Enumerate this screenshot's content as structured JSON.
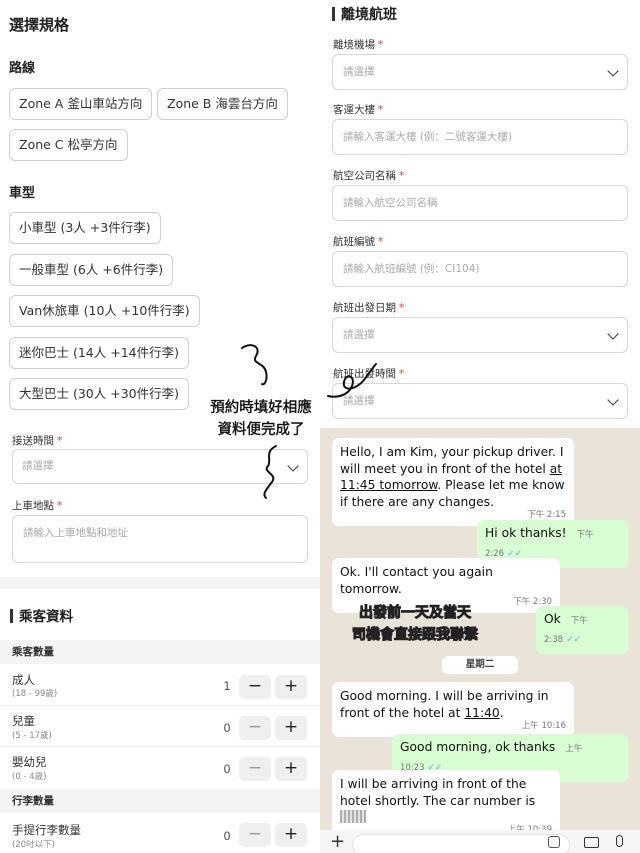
{
  "left": {
    "title": "選擇規格",
    "route": {
      "heading": "路線",
      "options": [
        "Zone A 釜山車站方向",
        "Zone B 海雲台方向",
        "Zone C 松亭方向"
      ]
    },
    "vehicle": {
      "heading": "車型",
      "options": [
        "小車型 (3人 +3件行李)",
        "一般車型 (6人 +6件行李)",
        "Van休旅車 (10人 +10件行李)",
        "迷你巴士 (14人 +14件行李)",
        "大型巴士 (30人 +30件行李)"
      ]
    },
    "pickup_time": {
      "label": "接送時間",
      "placeholder": "請選擇"
    },
    "pickup_place": {
      "label": "上車地點",
      "placeholder": "請輸入上車地點和地址"
    },
    "passenger": {
      "title": "乘客資料",
      "count_heading": "乘客數量",
      "rows": [
        {
          "label": "成人",
          "range": "(18 - 99歲)",
          "count": "1"
        },
        {
          "label": "兒童",
          "range": "(5 - 17歲)",
          "count": "0"
        },
        {
          "label": "嬰幼兒",
          "range": "(0 - 4歲)",
          "count": "0"
        }
      ],
      "luggage_heading": "行李數量",
      "luggage_rows": [
        {
          "label": "手提行李數量",
          "range": "(20吋以下)",
          "count": "0"
        }
      ],
      "minus": "−",
      "plus": "+"
    },
    "required_mark": "*"
  },
  "flight": {
    "title": "離境航班",
    "fields": [
      {
        "label": "離境機場",
        "placeholder": "請選擇",
        "type": "select"
      },
      {
        "label": "客運大樓",
        "placeholder": "請輸入客運大樓 (例：二號客運大樓)",
        "type": "input"
      },
      {
        "label": "航空公司名稱",
        "placeholder": "請輸入航空公司名稱",
        "type": "input"
      },
      {
        "label": "航班編號",
        "placeholder": "請輸入航班編號 (例：CI104)",
        "type": "input"
      },
      {
        "label": "航班出發日期",
        "placeholder": "請選擇",
        "type": "select"
      },
      {
        "label": "航班出發時間",
        "placeholder": "請選擇",
        "type": "select"
      }
    ]
  },
  "chat": {
    "messages": [
      {
        "dir": "in",
        "parts": [
          "Hello, I am Kim, your pickup driver. I will meet you in front of the hotel ",
          "at 11:45 tomorrow",
          ". Please let me know if there are any changes."
        ],
        "time": "下午 2:15"
      },
      {
        "dir": "out",
        "text": "Hi ok thanks!",
        "time": "下午 2:26"
      },
      {
        "dir": "in",
        "text": "Ok. I'll contact you again tomorrow.",
        "time": "下午 2:30"
      },
      {
        "dir": "out",
        "text": "Ok",
        "time": "下午 2:38"
      },
      {
        "dir": "in",
        "parts": [
          "Good morning. I will be arriving in front of the hotel at ",
          "11:40",
          "."
        ],
        "time": "上午 10:16"
      },
      {
        "dir": "out",
        "text": "Good morning, ok thanks",
        "time": "上午 10:23"
      },
      {
        "dir": "in",
        "text": "I will be arriving in front of the hotel shortly. The car number is",
        "time": "上午 10:39"
      }
    ],
    "date_divider": "星期二",
    "tick_glyph": "✓✓"
  },
  "annotations": {
    "note1_line1": "預約時填好相應",
    "note1_line2": "資料便完成了",
    "note2_line1": "出發前一天及當天",
    "note2_line2": "司機會直接跟我聯繫"
  },
  "colors": {
    "required": "#e23b3b",
    "chat_bg": "#e9e3d8",
    "outgoing": "#d9fdd3",
    "ticks": "#4fb6ec"
  }
}
